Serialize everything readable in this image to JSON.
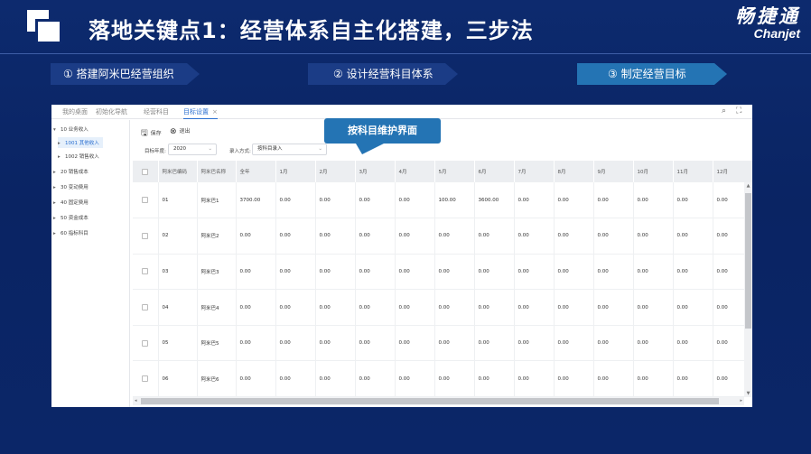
{
  "slide": {
    "title": "落地关键点1：经营体系自主化搭建，三步法",
    "brand_cn": "畅捷通",
    "brand_en": "Chanjet"
  },
  "steps": [
    "① 搭建阿米巴经营组织",
    "② 设计经营科目体系",
    "③ 制定经营目标"
  ],
  "app": {
    "tabs": [
      {
        "label": "我的桌面"
      },
      {
        "label": "初始化导航"
      },
      {
        "label": "经营科目"
      },
      {
        "label": "目标设置",
        "close": "×"
      }
    ],
    "top_icons": {
      "search": "⌕",
      "expand": "⛶"
    },
    "sidebar": [
      {
        "label": "10 业务收入",
        "caret": "▾"
      },
      {
        "label": "1001 其他收入",
        "caret": "▸"
      },
      {
        "label": "1002 销售收入",
        "caret": "▸"
      },
      {
        "label": "20 销售成本",
        "caret": "▸"
      },
      {
        "label": "30 变动费用",
        "caret": "▸"
      },
      {
        "label": "40 固定费用",
        "caret": "▸"
      },
      {
        "label": "50 资金成本",
        "caret": "▸"
      },
      {
        "label": "60 指标科目",
        "caret": "▸"
      }
    ],
    "toolbar": {
      "save_label": "保存",
      "exit_label": "退出",
      "save_icon": "🖫",
      "exit_icon": "⊗"
    },
    "filters": {
      "year_label": "目标年度:",
      "year_value": "2020",
      "mode_label": "录入方式:",
      "mode_value": "按科目录入"
    },
    "callout": "按科目维护界面",
    "table": {
      "headers": [
        "阿米巴编码",
        "阿米巴名称",
        "全年",
        "1月",
        "2月",
        "3月",
        "4月",
        "5月",
        "6月",
        "7月",
        "8月",
        "9月",
        "10月",
        "11月",
        "12月"
      ],
      "rows": [
        [
          "01",
          "阿米巴1",
          "3700.00",
          "0.00",
          "0.00",
          "0.00",
          "0.00",
          "100.00",
          "3600.00",
          "0.00",
          "0.00",
          "0.00",
          "0.00",
          "0.00",
          "0.00"
        ],
        [
          "02",
          "阿米巴2",
          "0.00",
          "0.00",
          "0.00",
          "0.00",
          "0.00",
          "0.00",
          "0.00",
          "0.00",
          "0.00",
          "0.00",
          "0.00",
          "0.00",
          "0.00"
        ],
        [
          "03",
          "阿米巴3",
          "0.00",
          "0.00",
          "0.00",
          "0.00",
          "0.00",
          "0.00",
          "0.00",
          "0.00",
          "0.00",
          "0.00",
          "0.00",
          "0.00",
          "0.00"
        ],
        [
          "04",
          "阿米巴4",
          "0.00",
          "0.00",
          "0.00",
          "0.00",
          "0.00",
          "0.00",
          "0.00",
          "0.00",
          "0.00",
          "0.00",
          "0.00",
          "0.00",
          "0.00"
        ],
        [
          "05",
          "阿米巴5",
          "0.00",
          "0.00",
          "0.00",
          "0.00",
          "0.00",
          "0.00",
          "0.00",
          "0.00",
          "0.00",
          "0.00",
          "0.00",
          "0.00",
          "0.00"
        ],
        [
          "06",
          "阿米巴6",
          "0.00",
          "0.00",
          "0.00",
          "0.00",
          "0.00",
          "0.00",
          "0.00",
          "0.00",
          "0.00",
          "0.00",
          "0.00",
          "0.00",
          "0.00"
        ]
      ]
    },
    "scroll_arrows": {
      "up": "▲",
      "down": "▼",
      "left": "◂",
      "right": "▸"
    }
  },
  "colors": {
    "background": "#0d2a6e",
    "step_normal": "#1b3c86",
    "step_active": "#2474b4",
    "callout": "#2474b4",
    "active_tab": "#2b6fd0"
  }
}
